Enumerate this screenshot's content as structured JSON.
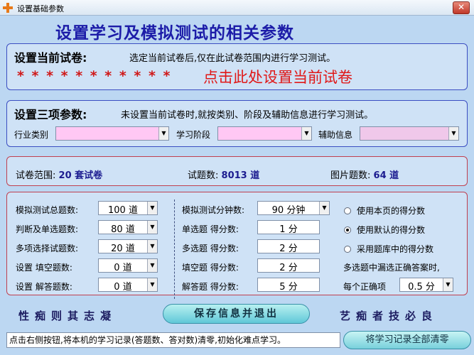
{
  "window": {
    "title": "设置基础参数",
    "close_glyph": "✕"
  },
  "main_title": "设置学习及模拟测试的相关参数",
  "current_paper": {
    "label": "设置当前试卷:",
    "description": "选定当前试卷后,仅在此试卷范围内进行学习测试。",
    "stars": "* * * * * * * * * * *",
    "link": "点击此处设置当前试卷"
  },
  "three_params": {
    "label": "设置三项参数:",
    "description": "未设置当前试卷时,就按类别、阶段及辅助信息进行学习测试。",
    "fields": [
      {
        "label": "行业类别",
        "value": ""
      },
      {
        "label": "学习阶段",
        "value": ""
      },
      {
        "label": "辅助信息",
        "value": ""
      }
    ]
  },
  "info": {
    "range_label": "试卷范围:",
    "range_value": "20 套试卷",
    "count_label": "试题数:",
    "count_value": "8013 道",
    "image_label": "图片题数:",
    "image_value": "64 道"
  },
  "params": {
    "left": [
      {
        "label": "模拟测试总题数:",
        "value": "100 道"
      },
      {
        "label": "判断及单选题数:",
        "value": "80 道"
      },
      {
        "label": "多项选择试题数:",
        "value": "20 道"
      },
      {
        "label": "设置 填空题数:",
        "value": "0 道"
      },
      {
        "label": "设置 解答题数:",
        "value": "0 道"
      }
    ],
    "middle": [
      {
        "label": "模拟测试分钟数:",
        "value": "90 分钟"
      },
      {
        "label": "单选题 得分数:",
        "value": "1 分"
      },
      {
        "label": "多选题 得分数:",
        "value": "2 分"
      },
      {
        "label": "填空题 得分数:",
        "value": "2 分"
      },
      {
        "label": "解答题 得分数:",
        "value": "5 分"
      }
    ],
    "radios": [
      {
        "label": "使用本页的得分数",
        "checked": false
      },
      {
        "label": "使用默认的得分数",
        "checked": true
      },
      {
        "label": "采用题库中的得分数",
        "checked": false
      }
    ],
    "partial_note": "多选题中漏选正确答案时,",
    "per_correct_label": "每个正确项",
    "per_correct_value": "0.5 分"
  },
  "footer": {
    "motto_left": "性痴则其志凝",
    "save_button": "保存信息并退出",
    "motto_right": "艺痴者技必良",
    "status_text": "点击右侧按钮,将本机的学习记录(答题数、答对数)清零,初始化难点学习。",
    "clear_button": "将学习记录全部清零"
  },
  "dropdown_glyph": "▼",
  "colors": {
    "title_blue": "#1c1ca8",
    "link_red": "#e01818",
    "combo_pink": "#ffc8f4",
    "background": "#bcd7f2"
  }
}
